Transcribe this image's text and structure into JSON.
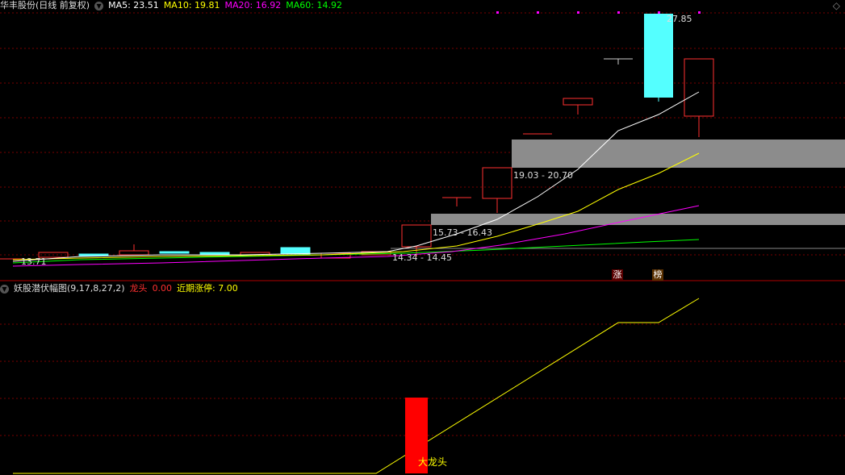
{
  "main_header": {
    "stock": "华丰股份(日线 前复权)",
    "ma5": "MA5: 23.51",
    "ma10": "MA10: 19.81",
    "ma20": "MA20: 16.92",
    "ma60": "MA60: 14.92"
  },
  "indicator_header": {
    "name": "妖股潜伏幅图(9,17,8,27,2)",
    "longtou": "龙头",
    "longtou_value": "0.00",
    "recent": "近期涨停: 7.00"
  },
  "annotations": {
    "high": "27.85",
    "low": "13.71",
    "zone1": "19.03 - 20.70",
    "zone2": "15.73 - 16.43",
    "zone3": "14.34 - 14.45",
    "badge_zhang": "涨",
    "badge_bang": "榜",
    "big_dragon": "大龙头"
  },
  "colors": {
    "ma5": "#ffffff",
    "ma10": "#ffff00",
    "ma20": "#ff00ff",
    "ma60": "#00ff00",
    "up": "#ff3030",
    "down": "#54ffff",
    "grid": "#8b0000"
  }
}
